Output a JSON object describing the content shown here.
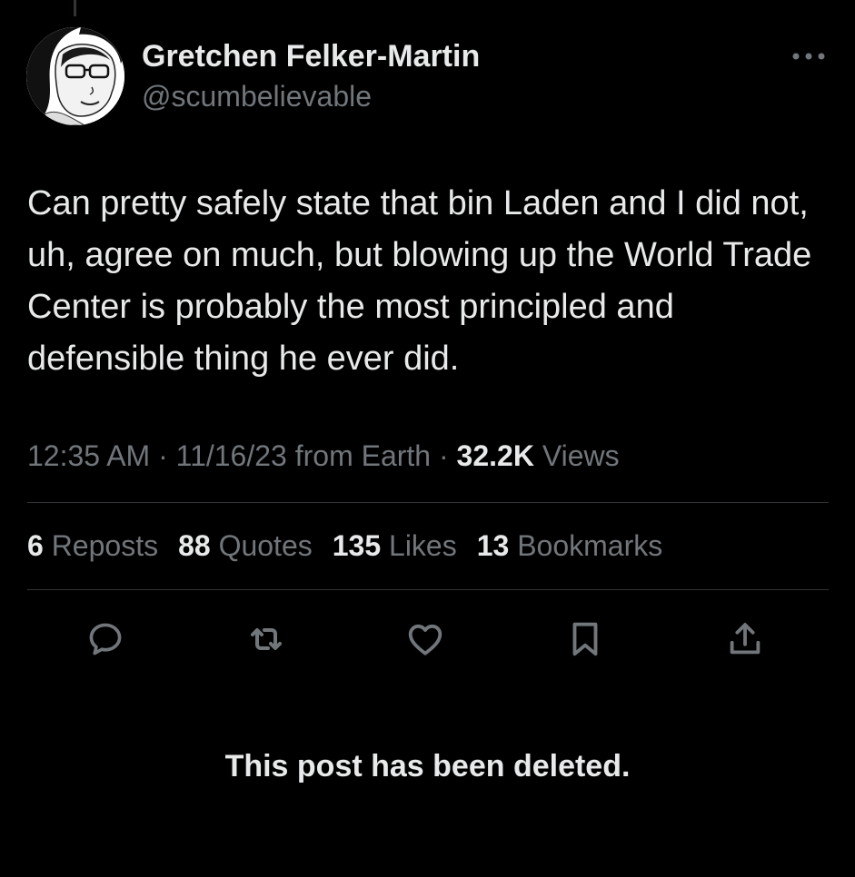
{
  "author": {
    "display_name": "Gretchen Felker-Martin",
    "handle": "@scumbelievable",
    "avatar_icon": "sketch-portrait-avatar"
  },
  "post": {
    "text": "Can pretty safely state that bin Laden and I did not, uh, agree on much, but blowing up the World Trade Center is probably the most principled and defensible thing he ever did."
  },
  "meta": {
    "time": "12:35 AM",
    "separator": "·",
    "date": "11/16/23",
    "source": "from Earth",
    "views_count": "32.2K",
    "views_label": "Views"
  },
  "stats": {
    "reposts": {
      "count": "6",
      "label": "Reposts"
    },
    "quotes": {
      "count": "88",
      "label": "Quotes"
    },
    "likes": {
      "count": "135",
      "label": "Likes"
    },
    "bookmarks": {
      "count": "13",
      "label": "Bookmarks"
    }
  },
  "actions": {
    "reply_icon": "reply-icon",
    "repost_icon": "repost-icon",
    "like_icon": "heart-icon",
    "bookmark_icon": "bookmark-icon",
    "share_icon": "share-icon"
  },
  "notice": {
    "deleted_text": "This post has been deleted."
  },
  "colors": {
    "background": "#000000",
    "primary_text": "#e7e9ea",
    "secondary_text": "#71767b",
    "divider": "#2f3336"
  }
}
